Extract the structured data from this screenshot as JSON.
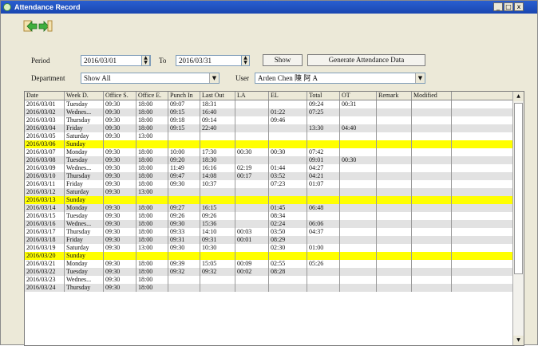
{
  "window": {
    "title": "Attendance Record",
    "min": "_",
    "max": "□",
    "close": "x"
  },
  "toolbar": {
    "back_icon": "green-left-arrow-icon",
    "forward_icon": "green-right-arrow-icon"
  },
  "filters": {
    "period_label": "Period",
    "from_date": "2016/03/01",
    "to_label": "To",
    "to_date": "2016/03/31",
    "show_button": "Show",
    "generate_button": "Generate Attendance Data",
    "department_label": "Department",
    "department_value": "Show All",
    "user_label": "User",
    "user_value": "Arden Chen 陳 阿 A"
  },
  "table": {
    "columns": [
      "Date",
      "Week D.",
      "Office S.",
      "Office E.",
      "Punch In",
      "Last Out",
      "LA",
      "EL",
      "Total",
      "OT",
      "Remark",
      "Modified"
    ],
    "rows": [
      [
        "2016/03/01",
        "Tuesday",
        "09:30",
        "18:00",
        "09:07",
        "18:31",
        "",
        "",
        "09:24",
        "00:31",
        "",
        ""
      ],
      [
        "2016/03/02",
        "Wednes...",
        "09:30",
        "18:00",
        "09:15",
        "16:40",
        "",
        "01:22",
        "07:25",
        "",
        "",
        ""
      ],
      [
        "2016/03/03",
        "Thursday",
        "09:30",
        "18:00",
        "09:18",
        "09:14",
        "",
        "09:46",
        "",
        "",
        "",
        ""
      ],
      [
        "2016/03/04",
        "Friday",
        "09:30",
        "18:00",
        "09:15",
        "22:40",
        "",
        "",
        "13:30",
        "04:40",
        "",
        ""
      ],
      [
        "2016/03/05",
        "Saturday",
        "09:30",
        "13:00",
        "",
        "",
        "",
        "",
        "",
        "",
        "",
        ""
      ],
      [
        "2016/03/06",
        "Sunday",
        "",
        "",
        "",
        "",
        "",
        "",
        "",
        "",
        "",
        ""
      ],
      [
        "2016/03/07",
        "Monday",
        "09:30",
        "18:00",
        "10:00",
        "17:30",
        "00:30",
        "00:30",
        "07:42",
        "",
        "",
        ""
      ],
      [
        "2016/03/08",
        "Tuesday",
        "09:30",
        "18:00",
        "09:20",
        "18:30",
        "",
        "",
        "09:01",
        "00:30",
        "",
        ""
      ],
      [
        "2016/03/09",
        "Wednes...",
        "09:30",
        "18:00",
        "11:49",
        "16:16",
        "02:19",
        "01:44",
        "04:27",
        "",
        "",
        ""
      ],
      [
        "2016/03/10",
        "Thursday",
        "09:30",
        "18:00",
        "09:47",
        "14:08",
        "00:17",
        "03:52",
        "04:21",
        "",
        "",
        ""
      ],
      [
        "2016/03/11",
        "Friday",
        "09:30",
        "18:00",
        "09:30",
        "10:37",
        "",
        "07:23",
        "01:07",
        "",
        "",
        ""
      ],
      [
        "2016/03/12",
        "Saturday",
        "09:30",
        "13:00",
        "",
        "",
        "",
        "",
        "",
        "",
        "",
        ""
      ],
      [
        "2016/03/13",
        "Sunday",
        "",
        "",
        "",
        "",
        "",
        "",
        "",
        "",
        "",
        ""
      ],
      [
        "2016/03/14",
        "Monday",
        "09:30",
        "18:00",
        "09:27",
        "16:15",
        "",
        "01:45",
        "06:48",
        "",
        "",
        ""
      ],
      [
        "2016/03/15",
        "Tuesday",
        "09:30",
        "18:00",
        "09:26",
        "09:26",
        "",
        "08:34",
        "",
        "",
        "",
        ""
      ],
      [
        "2016/03/16",
        "Wednes...",
        "09:30",
        "18:00",
        "09:30",
        "15:36",
        "",
        "02:24",
        "06:06",
        "",
        "",
        ""
      ],
      [
        "2016/03/17",
        "Thursday",
        "09:30",
        "18:00",
        "09:33",
        "14:10",
        "00:03",
        "03:50",
        "04:37",
        "",
        "",
        ""
      ],
      [
        "2016/03/18",
        "Friday",
        "09:30",
        "18:00",
        "09:31",
        "09:31",
        "00:01",
        "08:29",
        "",
        "",
        "",
        ""
      ],
      [
        "2016/03/19",
        "Saturday",
        "09:30",
        "13:00",
        "09:30",
        "10:30",
        "",
        "02:30",
        "01:00",
        "",
        "",
        ""
      ],
      [
        "2016/03/20",
        "Sunday",
        "",
        "",
        "",
        "",
        "",
        "",
        "",
        "",
        "",
        ""
      ],
      [
        "2016/03/21",
        "Monday",
        "09:30",
        "18:00",
        "09:39",
        "15:05",
        "00:09",
        "02:55",
        "05:26",
        "",
        "",
        ""
      ],
      [
        "2016/03/22",
        "Tuesday",
        "09:30",
        "18:00",
        "09:32",
        "09:32",
        "00:02",
        "08:28",
        "",
        "",
        "",
        ""
      ],
      [
        "2016/03/23",
        "Wednes...",
        "09:30",
        "18:00",
        "",
        "",
        "",
        "",
        "",
        "",
        "",
        ""
      ],
      [
        "2016/03/24",
        "Thursday",
        "09:30",
        "18:00",
        "",
        "",
        "",
        "",
        "",
        "",
        "",
        ""
      ]
    ]
  },
  "colors": {
    "weekend_row": "#ffff00",
    "alt_row": "#e2e2e2",
    "title_bar": "#2a5fd0"
  }
}
